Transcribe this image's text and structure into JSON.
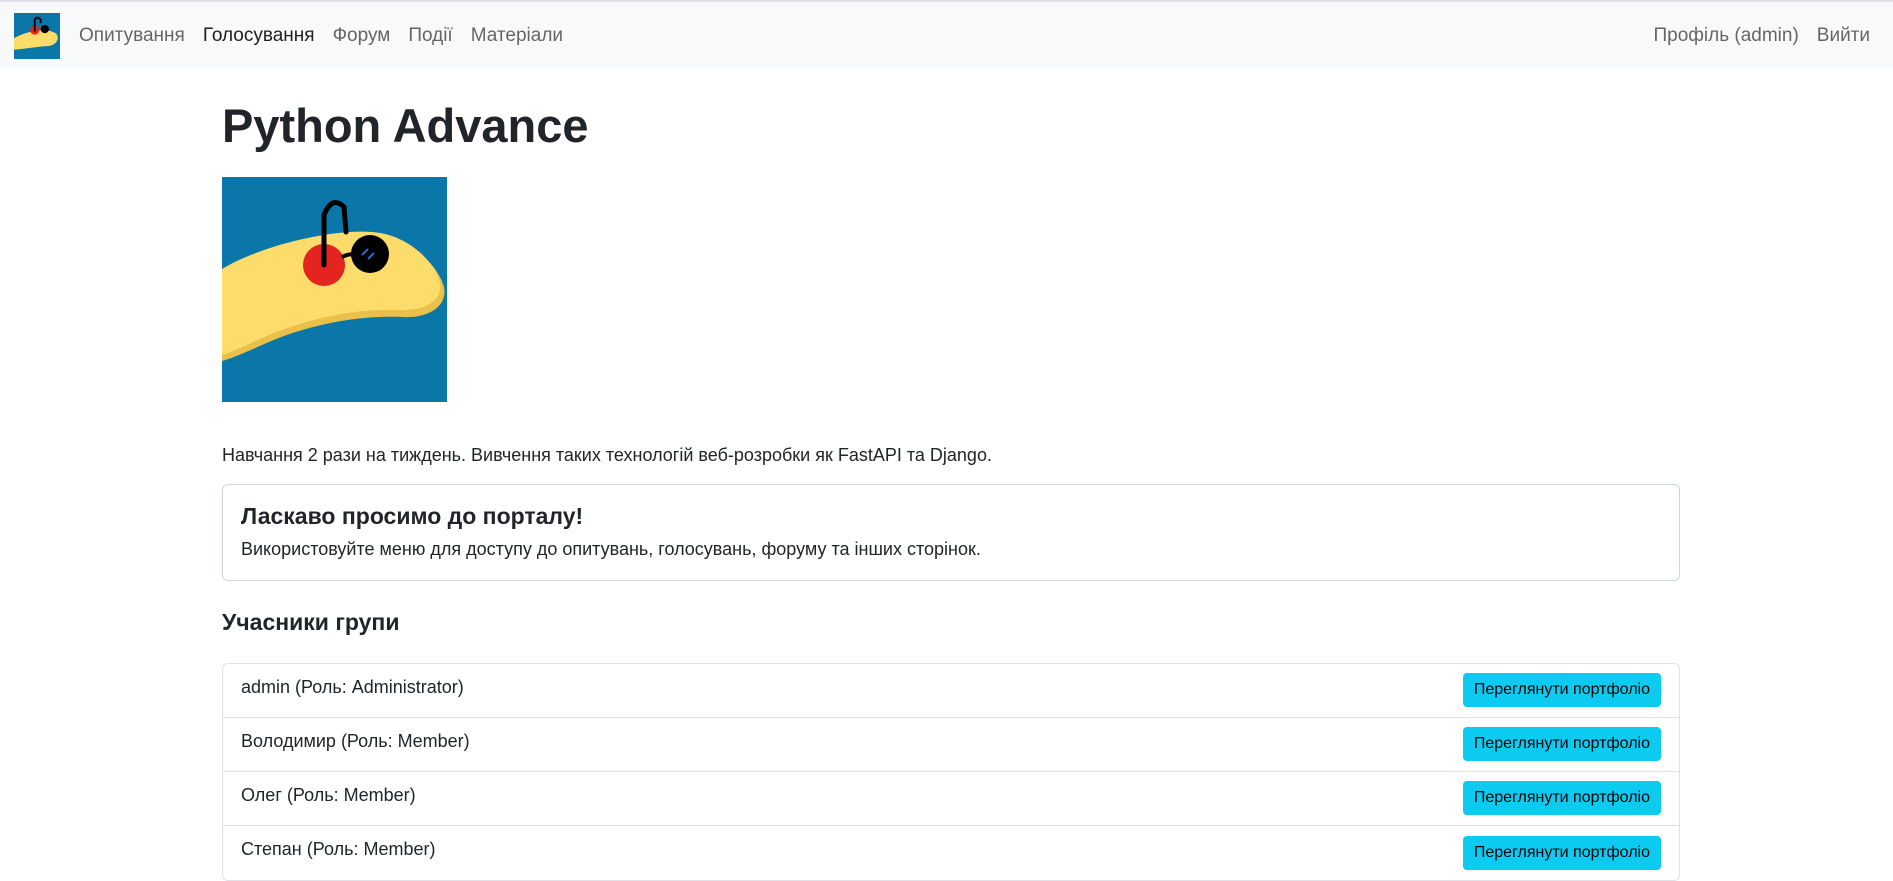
{
  "navbar": {
    "logo_icon": "python-mascot-logo-icon",
    "items": [
      {
        "label": "Опитування",
        "active": false
      },
      {
        "label": "Голосування",
        "active": true
      },
      {
        "label": "Форум",
        "active": false
      },
      {
        "label": "Події",
        "active": false
      },
      {
        "label": "Матеріали",
        "active": false
      }
    ],
    "profile_label": "Профіль (admin)",
    "logout_label": "Вийти"
  },
  "group": {
    "title": "Python Advance",
    "image_icon": "python-mascot-image",
    "description": "Навчання 2 рази на тиждень. Вивчення таких технологій веб-розробки як FastAPI та Django."
  },
  "welcome": {
    "title": "Ласкаво просимо до порталу!",
    "text": "Використовуйте меню для доступу до опитувань, голосувань, форуму та інших сторінок."
  },
  "members": {
    "heading": "Учасники групи",
    "button_label": "Переглянути портфоліо",
    "list": [
      {
        "text": "admin (Роль: Administrator)"
      },
      {
        "text": "Володимир (Роль: Member)"
      },
      {
        "text": "Олег (Роль: Member)"
      },
      {
        "text": "Степан (Роль: Member)"
      }
    ]
  },
  "colors": {
    "navbar_bg": "#f8f9fa",
    "button_bg": "#0dcaf0",
    "image_bg": "#0a77a8",
    "mascot_yellow": "#fddc6c",
    "mascot_red": "#e3241f"
  }
}
